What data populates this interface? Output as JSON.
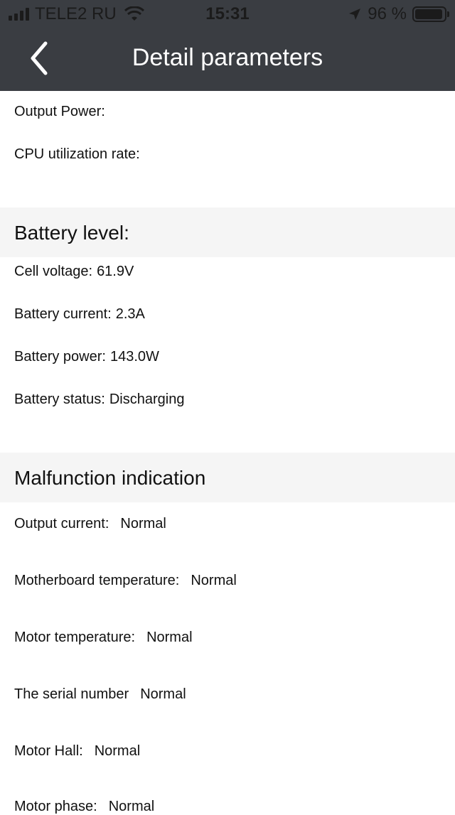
{
  "status": {
    "carrier": "TELE2 RU",
    "time": "15:31",
    "battery_percent": "96 %",
    "battery_level": 0.96
  },
  "nav": {
    "title": "Detail parameters"
  },
  "top_rows": [
    {
      "label": "Output Power:",
      "value": ""
    },
    {
      "label": "CPU utilization rate:",
      "value": ""
    }
  ],
  "battery_section": {
    "title": "Battery level:",
    "rows": [
      {
        "label": "Cell voltage:",
        "value": "61.9V"
      },
      {
        "label": "Battery current:",
        "value": "2.3A"
      },
      {
        "label": "Battery power:",
        "value": "143.0W"
      },
      {
        "label": "Battery status:",
        "value": "Discharging"
      }
    ]
  },
  "malfunction_section": {
    "title": "Malfunction indication",
    "rows": [
      {
        "label": "Output current:",
        "value": "Normal"
      },
      {
        "label": "Motherboard temperature:",
        "value": "Normal"
      },
      {
        "label": "Motor temperature:",
        "value": "Normal"
      },
      {
        "label": "The serial number",
        "value": "Normal"
      },
      {
        "label": "Motor Hall:",
        "value": "Normal"
      },
      {
        "label": "Motor phase:",
        "value": "Normal"
      }
    ]
  }
}
